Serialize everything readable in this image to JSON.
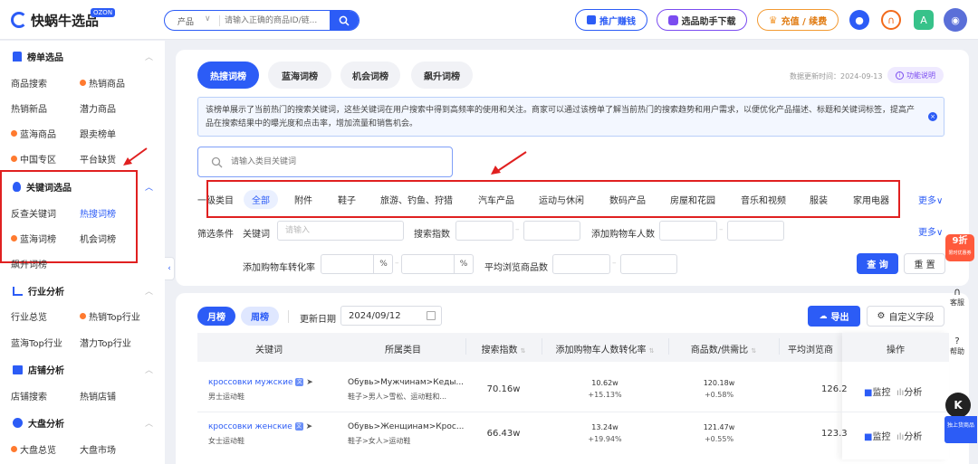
{
  "header": {
    "logo": "快蜗牛选品",
    "logo_badge": "OZON",
    "search_type": "产品",
    "search_placeholder": "请输入正确的商品ID/链...",
    "promo_button": "推广赚钱",
    "extension_button": "选品助手下载",
    "recharge_button": "充值 / 续费"
  },
  "sidebar": {
    "sections": [
      {
        "title": "榜单选品",
        "icon": "trophy-icon"
      },
      {
        "title": "关键词选品",
        "icon": "fire-icon"
      },
      {
        "title": "行业分析",
        "icon": "chart-icon"
      },
      {
        "title": "店铺分析",
        "icon": "store-icon"
      },
      {
        "title": "大盘分析",
        "icon": "pie-icon"
      }
    ],
    "items": {
      "product_search": "商品搜索",
      "hot_products": "热销商品",
      "hot_new": "热销新品",
      "potential_products": "潜力商品",
      "blue_ocean_products": "蓝海商品",
      "follow_list": "跟卖榜单",
      "china_zone": "中国专区",
      "platform_shortage": "平台缺货",
      "reverse_keyword": "反查关键词",
      "hot_search": "热搜词榜",
      "blue_ocean_words": "蓝海词榜",
      "opportunity_words": "机会词榜",
      "soaring_words": "飙升词榜",
      "industry_overview": "行业总览",
      "hot_top_industry": "热销Top行业",
      "blue_top_industry": "蓝海Top行业",
      "potential_top_industry": "潜力Top行业",
      "shop_search": "店铺搜索",
      "hot_shops": "热销店铺",
      "market_overview": "大盘总览",
      "market": "大盘市场"
    }
  },
  "tabs": [
    "热搜词榜",
    "蓝海词榜",
    "机会词榜",
    "飙升词榜"
  ],
  "update_time": "数据更新时间：2024-09-13",
  "help_link": "功能说明",
  "info_text": "该榜单展示了当前热门的搜索关键词，这些关键词在用户搜索中得到高频率的使用和关注。商家可以通过该榜单了解当前热门的搜索趋势和用户需求，以便优化产品描述、标题和关键词标签，提高产品在搜索结果中的曝光度和点击率，增加流量和销售机会。",
  "category_search_placeholder": "请输入类目关键词",
  "category": {
    "label": "一级类目",
    "items": [
      "全部",
      "附件",
      "鞋子",
      "旅游、钓鱼、狩猎",
      "汽车产品",
      "运动与休闲",
      "数码产品",
      "房屋和花园",
      "音乐和视频",
      "服装",
      "家用电器"
    ],
    "more": "更多"
  },
  "filters": {
    "label": "筛选条件",
    "keyword_label": "关键词",
    "keyword_placeholder": "请输入",
    "search_index_label": "搜索指数",
    "add_cart_label": "添加购物车人数",
    "more": "更多",
    "conversion_label": "添加购物车转化率",
    "percent": "%",
    "avg_browse_label": "平均浏览商品数",
    "query_button": "查 询",
    "reset_button": "重 置"
  },
  "table_toolbar": {
    "monthly": "月榜",
    "weekly": "周榜",
    "update_date_label": "更新日期",
    "update_date": "2024/09/12",
    "export": "导出",
    "custom_fields": "自定义字段"
  },
  "table": {
    "headers": [
      "关键词",
      "所属类目",
      "搜索指数",
      "添加购物车人数转化率",
      "商品数/供需比",
      "平均浏览商",
      "操作"
    ],
    "monitor": "监控",
    "analyze": "分析",
    "rows": [
      {
        "keyword": "кроссовки мужские",
        "keyword_cn": "男士运动鞋",
        "category_ru": "Обувь>Мужчинам>Кеды...",
        "category_cn": "鞋子>男人>雪松、运动鞋和...",
        "search_index": "70.16w",
        "conv_main": "10.62w",
        "conv_sub": "+15.13%",
        "supply_main": "120.18w",
        "supply_sub": "+0.58%",
        "avg_browse": "126.2"
      },
      {
        "keyword": "кроссовки женские",
        "keyword_cn": "女士运动鞋",
        "category_ru": "Обувь>Женщинам>Крос...",
        "category_cn": "鞋子>女人>运动鞋",
        "search_index": "66.43w",
        "conv_main": "13.24w",
        "conv_sub": "+19.94%",
        "supply_main": "121.47w",
        "supply_sub": "+0.55%",
        "avg_browse": "123.3"
      }
    ]
  },
  "float": {
    "discount": "9折",
    "discount_sub": "限时优惠券",
    "service": "客服",
    "help": "帮助",
    "side_button": "独上货商品"
  },
  "colors": {
    "primary": "#2c5cf6",
    "highlight_box": "#e02020",
    "orange": "#ff7a2f"
  }
}
